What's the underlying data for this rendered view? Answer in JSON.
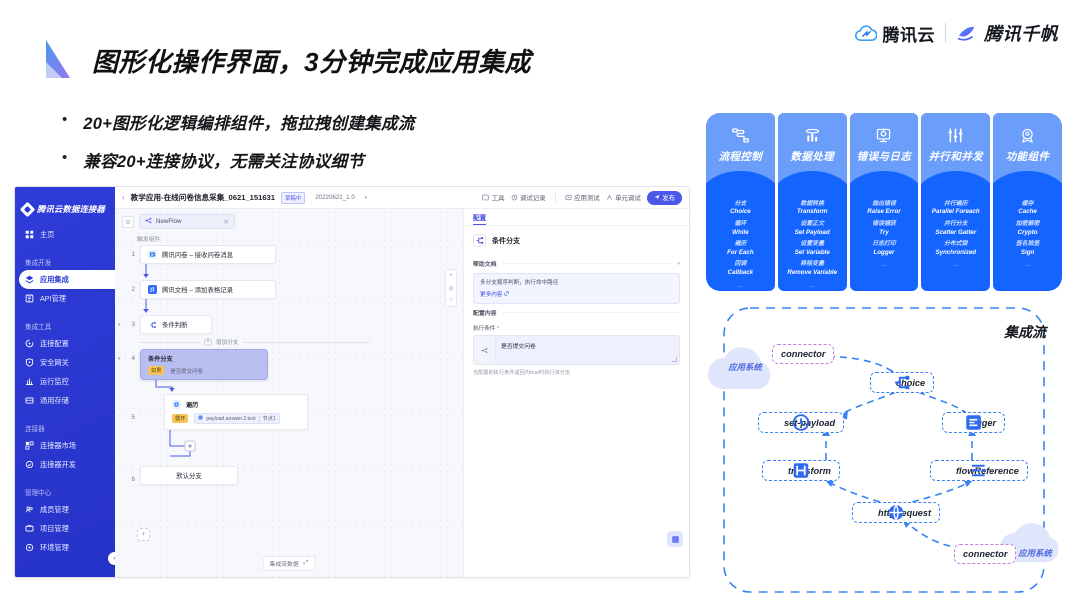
{
  "header": {
    "title": "图形化操作界面，3分钟完成应用集成",
    "brand_cloud": "腾讯云",
    "brand_qianfan": "腾讯千帆"
  },
  "bullets": [
    {
      "dot": "•",
      "text": "20+图形化逻辑编排组件，拖拉拽创建集成流"
    },
    {
      "dot": "•",
      "text": "兼容20+连接协议，无需关注协议细节"
    }
  ],
  "app": {
    "sidebar": {
      "logo": "腾讯云数据连接器",
      "items": [
        {
          "label": "主页",
          "icon": "home-icon",
          "active": false
        },
        {
          "label": "应用集成",
          "icon": "app-integration-icon",
          "active": true
        },
        {
          "label": "API管理",
          "icon": "api-icon",
          "active": false
        },
        {
          "label": "连接配置",
          "icon": "connect-config-icon",
          "active": false
        },
        {
          "label": "安全网关",
          "icon": "security-gateway-icon",
          "active": false
        },
        {
          "label": "运行监控",
          "icon": "monitor-icon",
          "active": false
        },
        {
          "label": "通用存储",
          "icon": "storage-icon",
          "active": false
        },
        {
          "label": "连接器市场",
          "icon": "market-icon",
          "active": false
        },
        {
          "label": "连接器开发",
          "icon": "dev-icon",
          "active": false
        },
        {
          "label": "成员管理",
          "icon": "members-icon",
          "active": false
        },
        {
          "label": "项目管理",
          "icon": "project-icon",
          "active": false
        },
        {
          "label": "环境管理",
          "icon": "environment-icon",
          "active": false
        }
      ],
      "groups": {
        "dev": "集成开发",
        "tools": "集成工具",
        "connector": "连接器",
        "admin": "管理中心"
      },
      "collapse": "‹"
    },
    "topbar": {
      "back": "‹",
      "title": "教学应用-在线问卷信息采集_0621_151631",
      "badge": "草稿中",
      "version": "20220621_1.0",
      "actions": [
        "工具",
        "调试记录",
        "应用测试",
        "单元调试"
      ],
      "publish": "发布"
    },
    "canvas": {
      "tab_name": "NewFlow",
      "tab_close": "✕",
      "trigger_label": "触发组件",
      "add_branch": "增加分支",
      "footer": "集成流数据",
      "nodes": [
        {
          "num": "1",
          "label": "腾讯问卷 – 接收问卷消息"
        },
        {
          "num": "2",
          "label": "腾讯文档 – 添加表格记录"
        },
        {
          "num": "3",
          "label": "条件判断"
        },
        {
          "num": "4",
          "label": "条件分支",
          "chip": "如果",
          "sub": "是否提交问卷"
        },
        {
          "num": "5",
          "label": "遍历",
          "chip": "循环",
          "expr": "payload.answer.2.text",
          "expr_tag": "节点1"
        },
        {
          "num": "6",
          "label": "默认分支"
        }
      ]
    },
    "config": {
      "tab": "配置",
      "node_title": "条件分支",
      "help_section": "帮助文档",
      "help_text": "多分支顺序判断，执行命中路径",
      "help_link": "更多内容",
      "content_section": "配置内容",
      "field_label": "执行条件",
      "field_required": "*",
      "field_value": "是否提交问卷",
      "field_hint": "当配置的执行条件返回为true时执行该分支"
    }
  },
  "cards": [
    {
      "title": "流程控制",
      "icon": "flow-control-icon",
      "items": [
        {
          "cn": "分支",
          "en": "Choice"
        },
        {
          "cn": "循环",
          "en": "While"
        },
        {
          "cn": "遍历",
          "en": "For Each"
        },
        {
          "cn": "回调",
          "en": "Callback"
        }
      ],
      "more": "…"
    },
    {
      "title": "数据处理",
      "icon": "data-process-icon",
      "items": [
        {
          "cn": "数据转换",
          "en": "Transform"
        },
        {
          "cn": "设置正文",
          "en": "Set Payload"
        },
        {
          "cn": "设置变量",
          "en": "Set Variable"
        },
        {
          "cn": "移除变量",
          "en": "Remove Variable"
        }
      ],
      "more": "…"
    },
    {
      "title": "错误与日志",
      "icon": "error-log-icon",
      "items": [
        {
          "cn": "抛出错误",
          "en": "Raise Error"
        },
        {
          "cn": "错误捕获",
          "en": "Try"
        },
        {
          "cn": "日志打印",
          "en": "Logger"
        }
      ],
      "more": "…"
    },
    {
      "title": "并行和并发",
      "icon": "parallel-icon",
      "items": [
        {
          "cn": "并行遍历",
          "en": "Parallel Foreach"
        },
        {
          "cn": "并行分支",
          "en": "Scatter Gatter"
        },
        {
          "cn": "分布式锁",
          "en": "Synchronized"
        }
      ],
      "more": "…"
    },
    {
      "title": "功能组件",
      "icon": "function-component-icon",
      "items": [
        {
          "cn": "缓存",
          "en": "Cache"
        },
        {
          "cn": "加密解密",
          "en": "Crypto"
        },
        {
          "cn": "签名验签",
          "en": "Sign"
        }
      ],
      "more": "…"
    }
  ],
  "diagram": {
    "title": "集成流",
    "cloud_left": "应用系统",
    "cloud_right": "应用系统",
    "nodes": {
      "connector_top": "connector",
      "choice": "choice",
      "set_payload": "set-payload",
      "logger": "logger",
      "transform": "transform",
      "flow_reference": "flowReference",
      "http_request": "http request",
      "connector_bottom": "connector"
    }
  },
  "colors": {
    "brand_blue": "#1464ff",
    "card_header": "#6b9dfb",
    "sidebar": "#2b38d4",
    "accent": "#4a57e8",
    "dashed": "#3b82f6",
    "connector": "#c07fe0"
  }
}
